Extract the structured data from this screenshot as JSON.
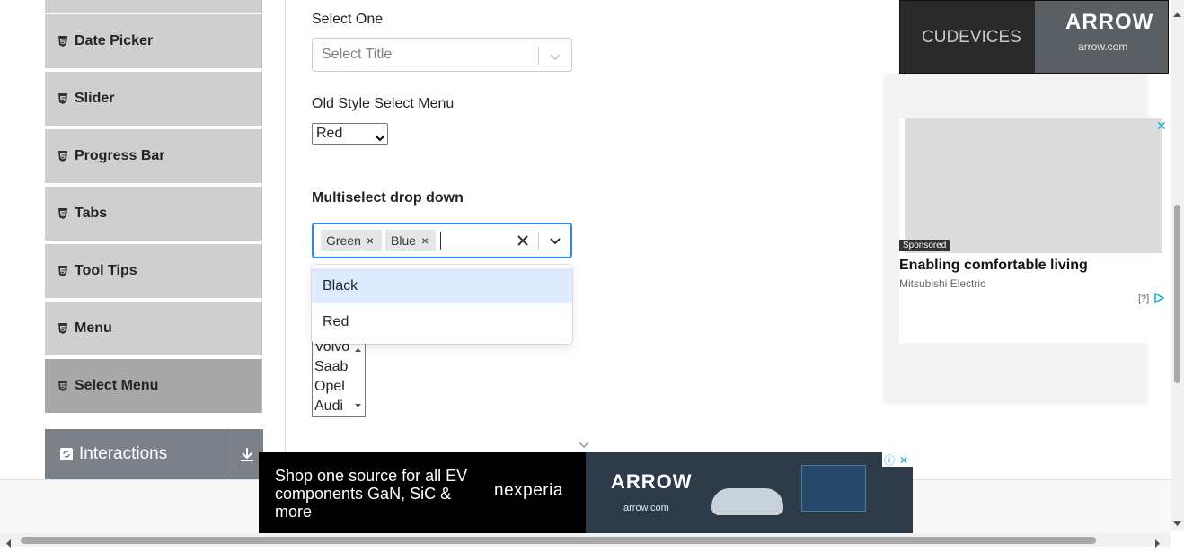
{
  "sidebar": {
    "items": [
      {
        "label": "Date Picker"
      },
      {
        "label": "Slider"
      },
      {
        "label": "Progress Bar"
      },
      {
        "label": "Tabs"
      },
      {
        "label": "Tool Tips"
      },
      {
        "label": "Menu"
      },
      {
        "label": "Select Menu",
        "active": true
      }
    ],
    "group": {
      "label": "Interactions"
    }
  },
  "main": {
    "select_one": {
      "label": "Select One",
      "placeholder": "Select Title"
    },
    "old_style": {
      "label": "Old Style Select Menu",
      "value": "Red"
    },
    "multiselect": {
      "label": "Multiselect drop down",
      "chips": [
        "Green",
        "Blue"
      ],
      "options": [
        "Black",
        "Red"
      ]
    },
    "listbox": {
      "items": [
        "Volvo",
        "Saab",
        "Opel",
        "Audi"
      ]
    }
  },
  "ads": {
    "top": {
      "brand": "CUDEVICES",
      "logo": "ARROW",
      "url": "arrow.com"
    },
    "card": {
      "sponsored": "Sponsored",
      "headline": "Enabling comfortable living",
      "advertiser": "Mitsubishi Electric",
      "info": "[?]"
    },
    "banner": {
      "copy": "Shop one source for all EV components GaN, SiC & more",
      "brand": "nexperia",
      "logo": "ARROW",
      "url": "arrow.com"
    }
  },
  "colors": {
    "focus": "#2684ff",
    "option_highlight": "#deebff",
    "sidebar_bg": "#cfcfcf",
    "sidebar_active": "#a8a8a8"
  }
}
